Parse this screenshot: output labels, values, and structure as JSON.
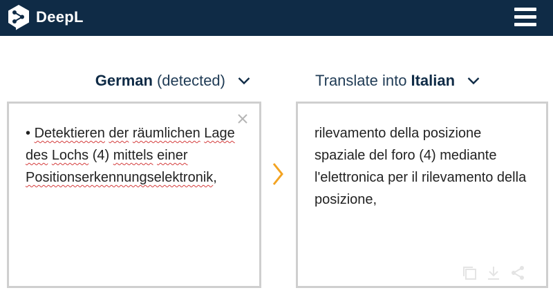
{
  "app": {
    "brand": "DeepL"
  },
  "source": {
    "language": "German",
    "detected_suffix": "(detected)",
    "text_prefix": "• ",
    "words": [
      {
        "t": "Detektieren",
        "sq": true
      },
      {
        "t": " ",
        "sq": false
      },
      {
        "t": "der",
        "sq": true
      },
      {
        "t": " ",
        "sq": false
      },
      {
        "t": "räumlichen",
        "sq": true
      },
      {
        "t": " ",
        "sq": false
      },
      {
        "t": "Lage",
        "sq": true
      },
      {
        "t": " ",
        "sq": false
      },
      {
        "t": "des",
        "sq": true
      },
      {
        "t": " ",
        "sq": false
      },
      {
        "t": "Lochs",
        "sq": true
      },
      {
        "t": " (4) ",
        "sq": false
      },
      {
        "t": "mittels",
        "sq": true
      },
      {
        "t": " ",
        "sq": false
      },
      {
        "t": "einer",
        "sq": true
      },
      {
        "t": " ",
        "sq": false
      },
      {
        "t": "Positionserkennungselektronik",
        "sq": true
      },
      {
        "t": ",",
        "sq": false
      }
    ]
  },
  "target": {
    "prefix": "Translate into",
    "language": "Italian",
    "text": "rilevamento della posizione spaziale del foro (4) mediante l'elettronica per il rilevamento della posizione,"
  },
  "colors": {
    "nav_bg": "#0f2b46",
    "accent_arrow": "#f3a321",
    "squiggle": "#d43b3b",
    "panel_border": "#cfcfcf"
  },
  "icons": {
    "menu": "hamburger-menu-icon",
    "clear": "close-icon",
    "swap": "chevron-right-icon",
    "copy": "copy-icon",
    "download": "download-icon",
    "share": "share-icon"
  }
}
